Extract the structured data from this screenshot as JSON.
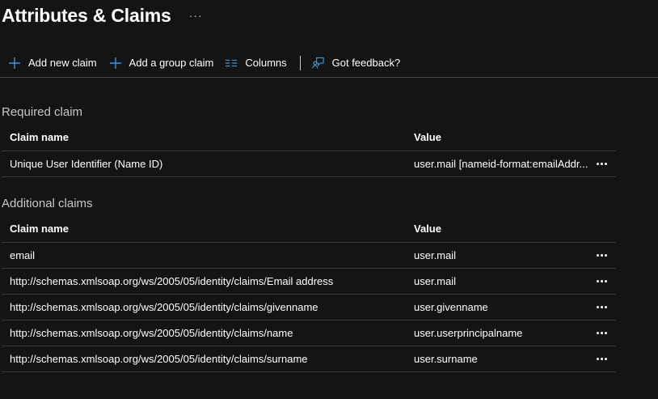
{
  "header": {
    "title": "Attributes & Claims",
    "more": "···"
  },
  "toolbar": {
    "add_new_claim": "Add new claim",
    "add_group_claim": "Add a group claim",
    "columns": "Columns",
    "feedback": "Got feedback?"
  },
  "required": {
    "title": "Required claim",
    "columns": {
      "name": "Claim name",
      "value": "Value"
    },
    "rows": [
      {
        "name": "Unique User Identifier (Name ID)",
        "value": "user.mail [nameid-format:emailAddr..."
      }
    ]
  },
  "additional": {
    "title": "Additional claims",
    "columns": {
      "name": "Claim name",
      "value": "Value"
    },
    "rows": [
      {
        "name": "email",
        "value": "user.mail"
      },
      {
        "name": "http://schemas.xmlsoap.org/ws/2005/05/identity/claims/Email address",
        "value": "user.mail"
      },
      {
        "name": "http://schemas.xmlsoap.org/ws/2005/05/identity/claims/givenname",
        "value": "user.givenname"
      },
      {
        "name": "http://schemas.xmlsoap.org/ws/2005/05/identity/claims/name",
        "value": "user.userprincipalname"
      },
      {
        "name": "http://schemas.xmlsoap.org/ws/2005/05/identity/claims/surname",
        "value": "user.surname"
      }
    ]
  },
  "colors": {
    "background": "#141414",
    "accent": "#3a96dd",
    "divider": "#3b3b3b"
  },
  "icons": {
    "add_new_claim": "plus-icon",
    "add_group_claim": "plus-icon",
    "columns": "columns-icon",
    "feedback": "feedback-icon",
    "row_more": "more-icon"
  }
}
